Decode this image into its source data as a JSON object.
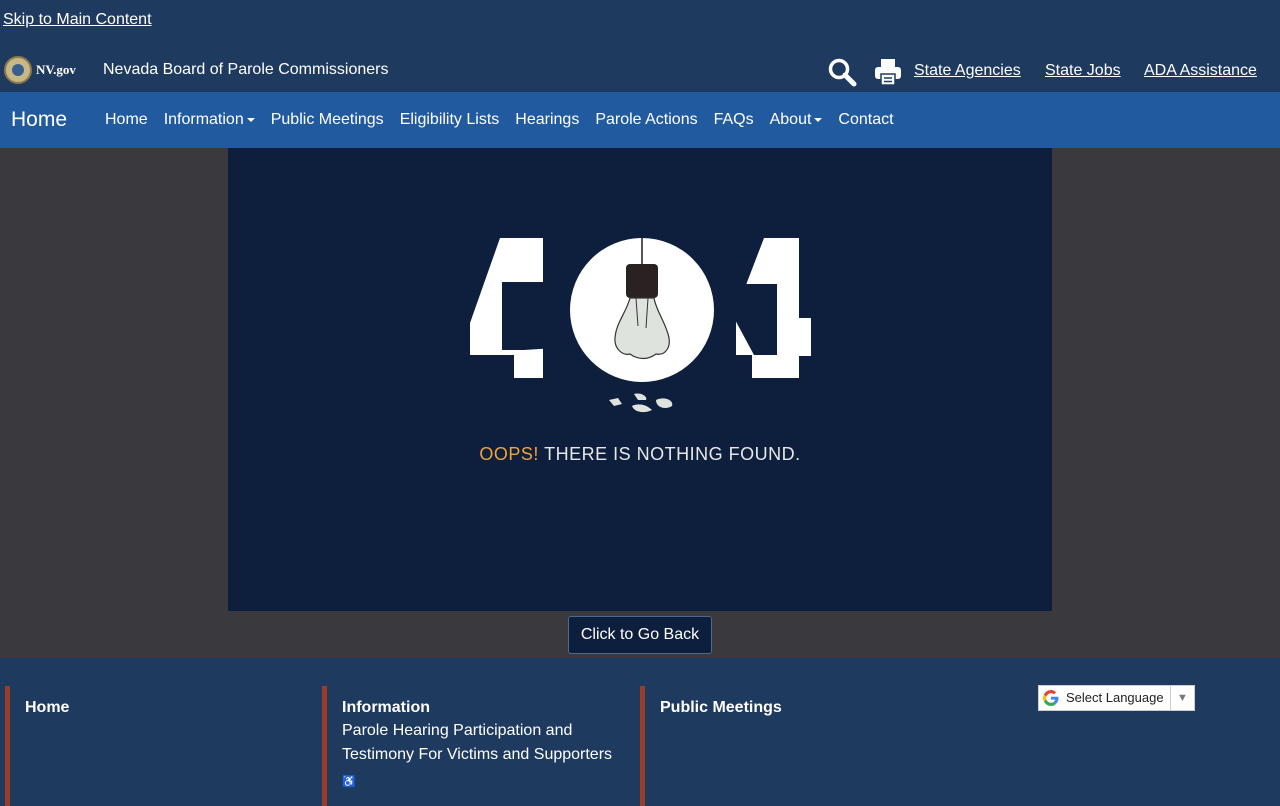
{
  "skip_link": "Skip to Main Content",
  "header": {
    "logo_text": "NV.gov",
    "agency_name": "Nevada Board of Parole Commissioners",
    "links": [
      "State Agencies",
      "State Jobs",
      "ADA Assistance"
    ]
  },
  "nav": {
    "brand": "Home",
    "items": [
      {
        "label": "Home",
        "dropdown": false
      },
      {
        "label": "Information",
        "dropdown": true
      },
      {
        "label": "Public Meetings",
        "dropdown": false
      },
      {
        "label": "Eligibility Lists",
        "dropdown": false
      },
      {
        "label": "Hearings",
        "dropdown": false
      },
      {
        "label": "Parole Actions",
        "dropdown": false
      },
      {
        "label": "FAQs",
        "dropdown": false
      },
      {
        "label": "About",
        "dropdown": true
      },
      {
        "label": "Contact",
        "dropdown": false
      }
    ]
  },
  "error": {
    "code": "404",
    "oops": "OOPS!",
    "message": "THERE IS NOTHING FOUND.",
    "button": "Click to Go Back"
  },
  "footer": {
    "columns": [
      {
        "heading": "Home",
        "links": []
      },
      {
        "heading": "Information",
        "links": [
          "Parole Hearing Participation and Testimony For Victims and Supporters"
        ]
      },
      {
        "heading": "Public Meetings",
        "links": []
      }
    ],
    "language_select": "Select Language"
  },
  "colors": {
    "header_bg": "#1f3a5f",
    "nav_bg": "#215a9e",
    "panel_bg": "#0d1f3c",
    "accent_orange": "#f0a23e",
    "footer_border": "#9a3c2a"
  }
}
